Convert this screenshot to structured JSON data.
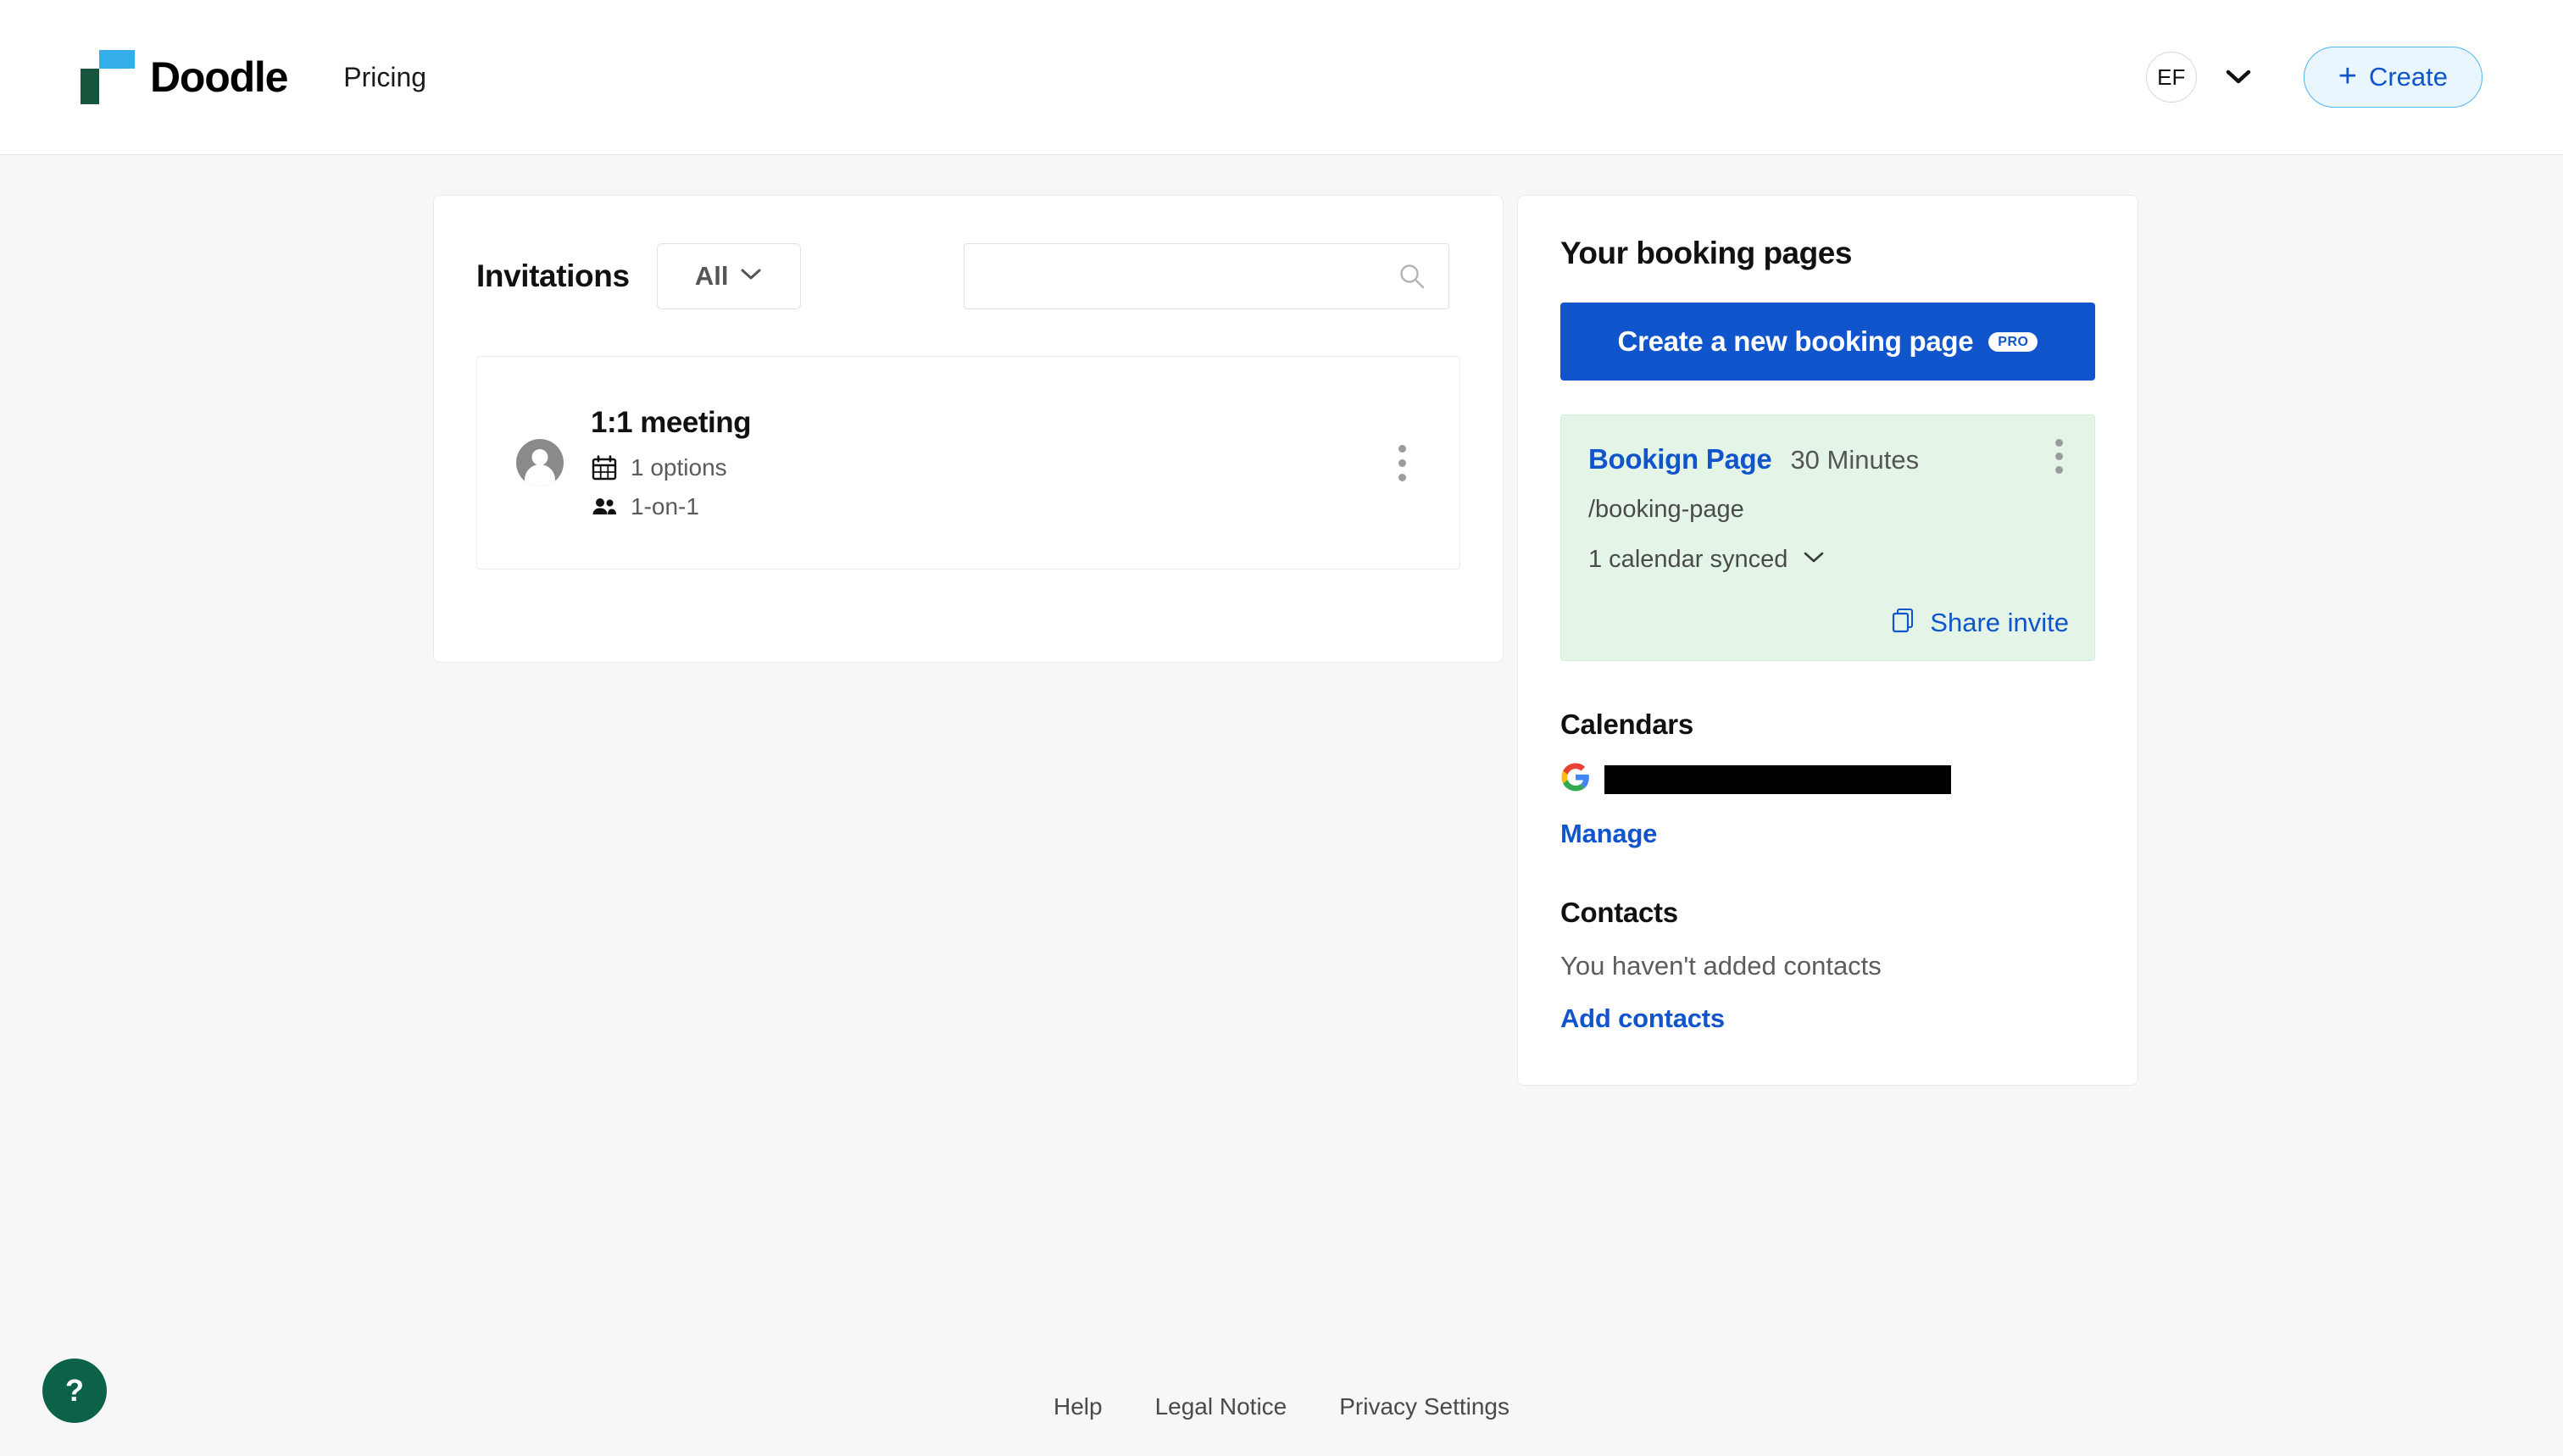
{
  "header": {
    "brand_name": "Doodle",
    "logo_icon": "doodle-squares-logo",
    "nav_items": [
      {
        "label": "Pricing"
      }
    ],
    "account": {
      "initials": "EF",
      "caret_icon": "chevron-down-icon"
    },
    "create_button": {
      "label": "Create",
      "icon": "plus-icon"
    }
  },
  "invitations": {
    "title": "Invitations",
    "filter": {
      "selected": "All",
      "caret_icon": "chevron-down-icon"
    },
    "search": {
      "value": "",
      "placeholder": "",
      "icon": "search-icon"
    },
    "items": [
      {
        "title": "1:1 meeting",
        "avatar_icon": "person-avatar-icon",
        "options_icon": "calendar-icon",
        "options_text": "1 options",
        "participants_icon": "people-icon",
        "participants_text": "1-on-1",
        "menu_icon": "kebab-menu-icon"
      }
    ]
  },
  "booking_pages": {
    "title": "Your booking pages",
    "create_button": {
      "label": "Create a new booking page",
      "badge": "PRO"
    },
    "pages": [
      {
        "name": "Bookign Page",
        "duration": "30 Minutes",
        "slug": "/booking-page",
        "calendar_synced": "1 calendar synced",
        "calendar_caret_icon": "chevron-down-icon",
        "share_label": "Share invite",
        "share_icon": "copy-icon",
        "menu_icon": "kebab-menu-icon"
      }
    ]
  },
  "calendars": {
    "title": "Calendars",
    "accounts": [
      {
        "provider_icon": "google-icon",
        "account_label": ""
      }
    ],
    "manage_link": "Manage"
  },
  "contacts": {
    "title": "Contacts",
    "empty_text": "You haven't added contacts",
    "add_link": "Add contacts"
  },
  "footer": {
    "links": [
      {
        "label": "Help"
      },
      {
        "label": "Legal Notice"
      },
      {
        "label": "Privacy Settings"
      }
    ]
  },
  "help_fab": {
    "label": "?"
  },
  "colors": {
    "brand_green": "#17563d",
    "brand_blue": "#34aee8",
    "accent_blue": "#1155cc",
    "card_green": "#e4f5e8",
    "page_bg": "#f7f7f7",
    "help_green": "#0c6149"
  }
}
